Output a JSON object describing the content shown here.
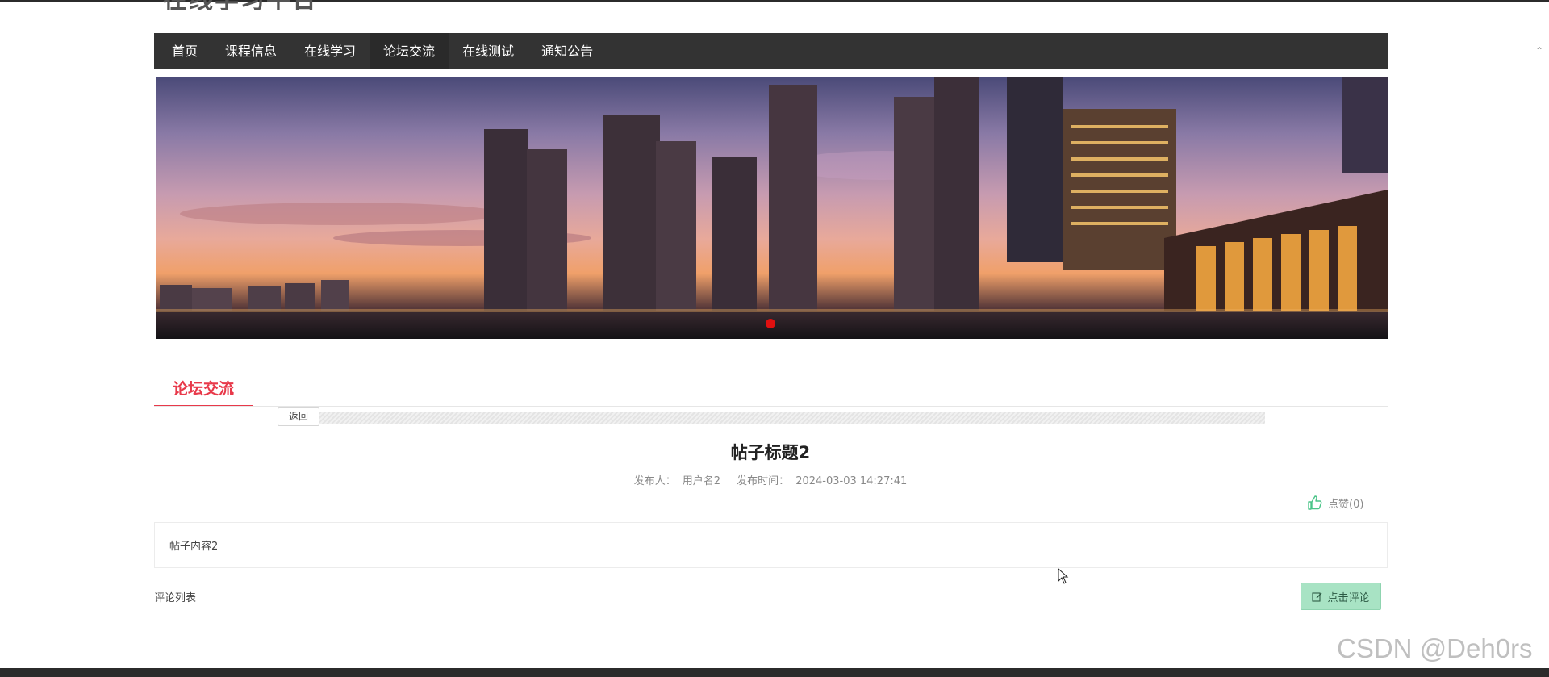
{
  "site": {
    "title": "在线学习平台"
  },
  "nav": {
    "items": [
      {
        "label": "首页"
      },
      {
        "label": "课程信息"
      },
      {
        "label": "在线学习"
      },
      {
        "label": "论坛交流"
      },
      {
        "label": "在线测试"
      },
      {
        "label": "通知公告"
      }
    ],
    "active_index": 3
  },
  "section": {
    "tab_label": "论坛交流",
    "back_label": "返回"
  },
  "post": {
    "title": "帖子标题2",
    "publisher_label": "发布人：",
    "publisher": "用户名2",
    "time_label": "发布时间：",
    "time": "2024-03-03 14:27:41",
    "like_label": "点赞(0)",
    "content": "帖子内容2"
  },
  "comments": {
    "label": "评论列表",
    "button_label": "点击评论"
  },
  "watermark": "CSDN @Deh0rs",
  "colors": {
    "accent": "#e8394a",
    "nav_bg": "#333333",
    "comment_button": "#a8e3c4",
    "like_icon": "#4bc488"
  }
}
